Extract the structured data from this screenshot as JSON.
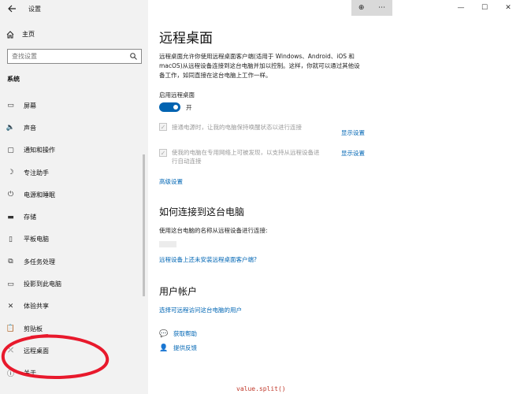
{
  "window": {
    "app_title": "设置",
    "controls": {
      "minimize": "—",
      "maximize": "☐",
      "close": "✕"
    },
    "zoom_icon": "⊕",
    "more_icon": "⋯"
  },
  "sidebar": {
    "home": "主页",
    "search_placeholder": "查找设置",
    "section": "系统",
    "items": [
      {
        "label": "屏幕",
        "icon": "▭"
      },
      {
        "label": "声音",
        "icon": "🔈"
      },
      {
        "label": "通知和操作",
        "icon": "▢"
      },
      {
        "label": "专注助手",
        "icon": "☽"
      },
      {
        "label": "电源和睡眠",
        "icon": "⏻"
      },
      {
        "label": "存储",
        "icon": "▬"
      },
      {
        "label": "平板电脑",
        "icon": "▯"
      },
      {
        "label": "多任务处理",
        "icon": "⧉"
      },
      {
        "label": "投影到此电脑",
        "icon": "▭"
      },
      {
        "label": "体验共享",
        "icon": "✕"
      },
      {
        "label": "剪贴板",
        "icon": "📋"
      },
      {
        "label": "远程桌面",
        "icon": "⤫"
      },
      {
        "label": "关于",
        "icon": "ⓘ"
      }
    ]
  },
  "main": {
    "title": "远程桌面",
    "description": "远程桌面允许你使用远程桌面客户端(适用于 Windows、Android、iOS 和 macOS)从远程设备连接到这台电脑并加以控制。这样，你就可以通过其他设备工作，如同直接在这台电脑上工作一样。",
    "enable_label": "启用远程桌面",
    "toggle_state": "开",
    "option1": "使电脑保持唤醒状态以进行连接",
    "option1_full": "接通电源时，让我的电脑保持唤醒状态以进行连接",
    "option2_line1": "使我的电脑在专用网络上可被发现，以支持从远程设备进",
    "option2_line2": "行自动连接",
    "show_settings": "显示设置",
    "advanced": "高级设置",
    "connect_heading": "如何连接到这台电脑",
    "connect_desc": "使用这台电脑的名称从远程设备进行连接:",
    "no_client_link": "远程设备上还未安装远程桌面客户端?",
    "accounts_heading": "用户帐户",
    "accounts_link": "选择可远程访问这台电脑的用户",
    "get_help": "获取帮助",
    "feedback": "提供反馈"
  },
  "annotation": {
    "color": "#e8192c",
    "code_fragment": "value.split()"
  }
}
